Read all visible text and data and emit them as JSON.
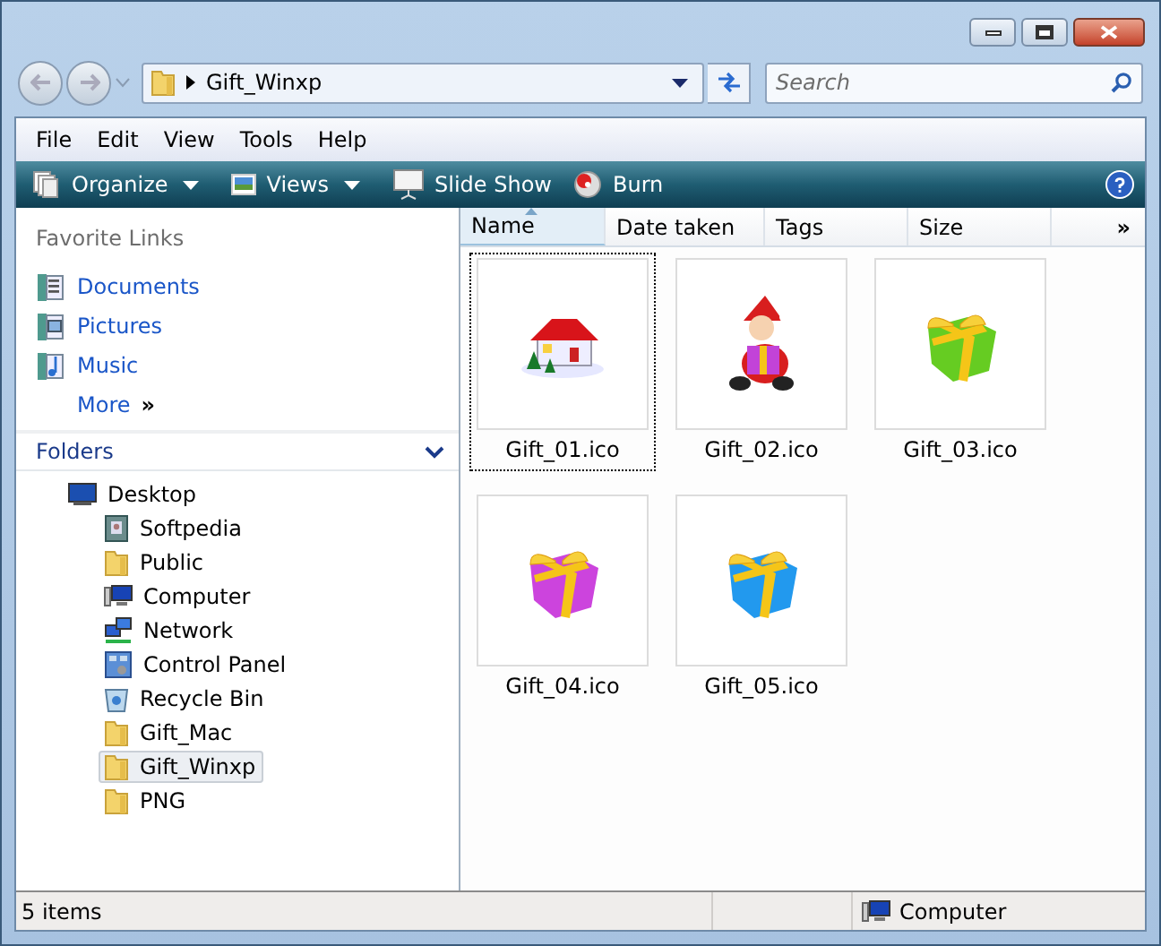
{
  "address": {
    "path": "Gift_Winxp"
  },
  "search": {
    "placeholder": "Search"
  },
  "menu": [
    "File",
    "Edit",
    "View",
    "Tools",
    "Help"
  ],
  "toolbar": [
    {
      "label": "Organize",
      "kind": "organize",
      "dropdown": true
    },
    {
      "label": "Views",
      "kind": "views",
      "dropdown": true
    },
    {
      "label": "Slide Show",
      "kind": "slideshow",
      "dropdown": false
    },
    {
      "label": "Burn",
      "kind": "burn",
      "dropdown": false
    }
  ],
  "favorite_links": {
    "title": "Favorite Links",
    "items": [
      {
        "label": "Documents",
        "kind": "documents"
      },
      {
        "label": "Pictures",
        "kind": "pictures"
      },
      {
        "label": "Music",
        "kind": "music"
      }
    ],
    "more": "More",
    "more_glyph": "»"
  },
  "folders": {
    "title": "Folders",
    "expanded": true,
    "tree": [
      {
        "label": "Desktop",
        "kind": "desktop",
        "selected": false,
        "children": [
          {
            "label": "Softpedia",
            "kind": "contacts",
            "selected": false
          },
          {
            "label": "Public",
            "kind": "folder",
            "selected": false
          },
          {
            "label": "Computer",
            "kind": "computer",
            "selected": false
          },
          {
            "label": "Network",
            "kind": "network",
            "selected": false
          },
          {
            "label": "Control Panel",
            "kind": "control",
            "selected": false
          },
          {
            "label": "Recycle Bin",
            "kind": "recycle",
            "selected": false
          },
          {
            "label": "Gift_Mac",
            "kind": "folder",
            "selected": false
          },
          {
            "label": "Gift_Winxp",
            "kind": "folder",
            "selected": true
          },
          {
            "label": "PNG",
            "kind": "folder",
            "selected": false
          }
        ]
      }
    ]
  },
  "columns": [
    {
      "label": "Name",
      "sorted": true
    },
    {
      "label": "Date taken",
      "sorted": false
    },
    {
      "label": "Tags",
      "sorted": false
    },
    {
      "label": "Size",
      "sorted": false
    }
  ],
  "columns_more": "»",
  "files": [
    {
      "name": "Gift_01.ico",
      "kind": "house",
      "selected": true
    },
    {
      "name": "Gift_02.ico",
      "kind": "santa",
      "selected": false
    },
    {
      "name": "Gift_03.ico",
      "kind": "gift",
      "color": "#66cc22",
      "selected": false
    },
    {
      "name": "Gift_04.ico",
      "kind": "gift",
      "color": "#cc44dd",
      "selected": false
    },
    {
      "name": "Gift_05.ico",
      "kind": "gift",
      "color": "#2299ee",
      "selected": false
    }
  ],
  "status_bar": {
    "count": "5 items",
    "location": "Computer"
  }
}
